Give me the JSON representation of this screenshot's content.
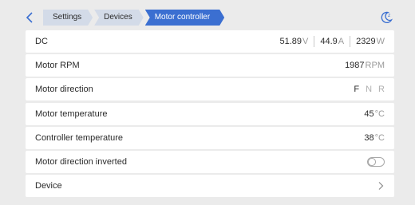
{
  "breadcrumbs": [
    "Settings",
    "Devices",
    "Motor controller"
  ],
  "rows": {
    "dc": {
      "label": "DC",
      "voltage": "51.89",
      "voltage_unit": "V",
      "current": "44.9",
      "current_unit": "A",
      "power": "2329",
      "power_unit": "W"
    },
    "rpm": {
      "label": "Motor RPM",
      "value": "1987",
      "unit": "RPM"
    },
    "direction": {
      "label": "Motor direction",
      "options": [
        "F",
        "N",
        "R"
      ],
      "selected": "F"
    },
    "motor_temp": {
      "label": "Motor temperature",
      "value": "45",
      "unit": "°C"
    },
    "controller_temp": {
      "label": "Controller temperature",
      "value": "38",
      "unit": "°C"
    },
    "inverted": {
      "label": "Motor direction inverted",
      "enabled": false
    },
    "device": {
      "label": "Device"
    }
  },
  "colors": {
    "accent": "#3b6fd1",
    "background": "#ebebeb",
    "row": "#ffffff",
    "unit": "#9a9a9a"
  },
  "icons": {
    "back": "chevron-left-icon",
    "theme": "moon-icon",
    "device": "chevron-right-icon"
  }
}
